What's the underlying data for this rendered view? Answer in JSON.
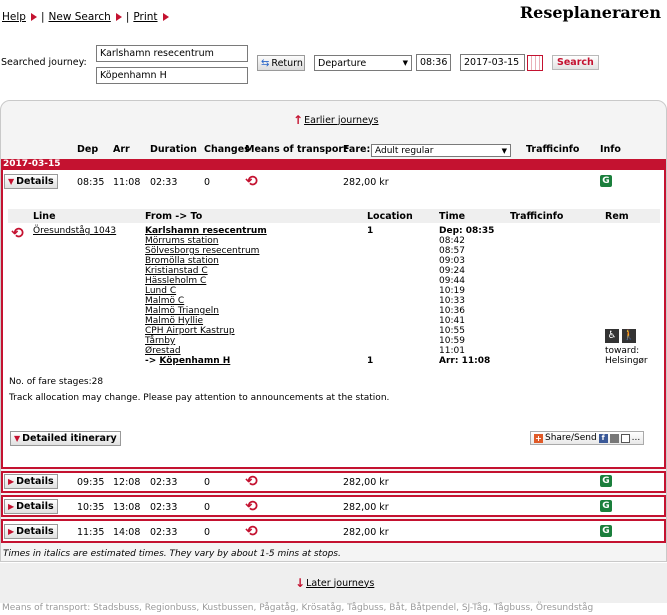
{
  "nav": {
    "help": "Help",
    "new_search": "New Search",
    "print": "Print",
    "separator": "|"
  },
  "app_title": "Reseplaneraren",
  "search": {
    "label": "Searched journey:",
    "from": "Karlshamn resecentrum",
    "to": "Köpenhamn H",
    "return_label": "Return",
    "direction": "Departure",
    "time": "08:36",
    "date": "2017-03-15",
    "search_label": "Search"
  },
  "results": {
    "earlier": "Earlier journeys",
    "later": "Later journeys",
    "columns": {
      "dep": "Dep",
      "arr": "Arr",
      "duration": "Duration",
      "changes": "Changes",
      "means": "Means of transport",
      "fare": "Fare:",
      "fare_type": "Adult regular",
      "trafficinfo": "Trafficinfo",
      "info": "Info"
    },
    "date": "2017-03-15",
    "details_label": "Details",
    "info_badge": "G",
    "journeys": [
      {
        "dep": "08:35",
        "arr": "11:08",
        "duration": "02:33",
        "changes": "0",
        "price": "282,00 kr"
      },
      {
        "dep": "09:35",
        "arr": "12:08",
        "duration": "02:33",
        "changes": "0",
        "price": "282,00 kr"
      },
      {
        "dep": "10:35",
        "arr": "13:08",
        "duration": "02:33",
        "changes": "0",
        "price": "282,00 kr"
      },
      {
        "dep": "11:35",
        "arr": "14:08",
        "duration": "02:33",
        "changes": "0",
        "price": "282,00 kr"
      }
    ],
    "detail": {
      "headers": {
        "line": "Line",
        "from_to": "From -> To",
        "location": "Location",
        "time": "Time",
        "trafficinfo": "Trafficinfo",
        "rem": "Rem"
      },
      "line": "Öresundståg 1043",
      "from_stop": "Karlshamn resecentrum",
      "from_location": "1",
      "dep_time": "Dep: 08:35",
      "stops": [
        {
          "name": "Mörrums station",
          "time": "08:42"
        },
        {
          "name": "Sölvesborgs resecentrum",
          "time": "08:57"
        },
        {
          "name": "Bromölla station",
          "time": "09:03"
        },
        {
          "name": "Kristianstad C",
          "time": "09:24"
        },
        {
          "name": "Hässleholm C",
          "time": "09:44"
        },
        {
          "name": "Lund C",
          "time": "10:19"
        },
        {
          "name": "Malmö C",
          "time": "10:33"
        },
        {
          "name": "Malmö Triangeln",
          "time": "10:36"
        },
        {
          "name": "Malmö Hyllie",
          "time": "10:41"
        },
        {
          "name": "CPH Airport Kastrup",
          "time": "10:55"
        },
        {
          "name": "Tårnby",
          "time": "10:59"
        },
        {
          "name": "Ørestad",
          "time": "11:01"
        }
      ],
      "arrow": "->",
      "to_stop": "Köpenhamn H",
      "to_location": "1",
      "arr_time": "Arr: 11:08",
      "toward_label": "toward:",
      "toward": "Helsingør",
      "fare_stages": "No. of fare stages:28",
      "track_note": "Track allocation may change. Please pay attention to announcements at the station.",
      "detailed_itinerary": "Detailed itinerary",
      "share": "Share/Send",
      "share_more": "...",
      "fb_letter": "f"
    }
  },
  "italic_note": "Times in italics are estimated times. They vary by about 1-5 mins at stops.",
  "means_list": "Means of transport: Stadsbuss, Regionbuss, Kustbussen, Pågatåg, Krösatåg, Tågbuss, Båt, Båtpendel, SJ-Tåg, Tågbuss, Öresundståg"
}
